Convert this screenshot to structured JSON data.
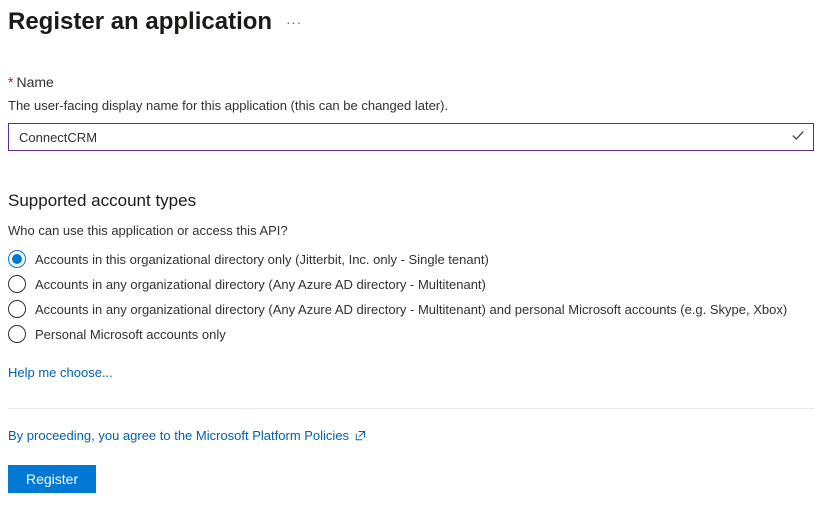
{
  "header": {
    "title": "Register an application"
  },
  "nameField": {
    "label": "Name",
    "help": "The user-facing display name for this application (this can be changed later).",
    "value": "ConnectCRM"
  },
  "accountTypes": {
    "header": "Supported account types",
    "help": "Who can use this application or access this API?",
    "selectedIndex": 0,
    "options": [
      "Accounts in this organizational directory only (Jitterbit, Inc. only - Single tenant)",
      "Accounts in any organizational directory (Any Azure AD directory - Multitenant)",
      "Accounts in any organizational directory (Any Azure AD directory - Multitenant) and personal Microsoft accounts (e.g. Skype, Xbox)",
      "Personal Microsoft accounts only"
    ],
    "helpLink": "Help me choose..."
  },
  "consent": {
    "text": "By proceeding, you agree to the Microsoft Platform Policies"
  },
  "actions": {
    "register": "Register"
  }
}
